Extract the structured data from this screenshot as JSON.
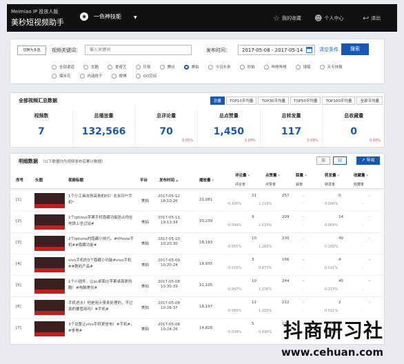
{
  "header": {
    "brand_sub": "Meimiao IP 投放人版",
    "brand_main": "美秒短视频助手",
    "skill_label": "一色神技能",
    "fav_label": "我的收藏",
    "user_label": "个人中心",
    "logout_label": "退出"
  },
  "filters": {
    "switch_label": "切换为多选",
    "keyword_label": "视频关键词：",
    "keyword_placeholder": "输入关键词",
    "date_label": "发布时间：",
    "date_value": "2017-05-08 - 2017-05-14",
    "clear_label": "清空条件",
    "search_label": "搜索",
    "platforms": [
      "全部渠道",
      "优酷",
      "爱奇艺",
      "乐视",
      "腾讯",
      "美拍",
      "今日头条",
      "秒拍",
      "哔哩哔哩",
      "搜狐",
      "天天快报",
      "爆米花",
      "内涵段子",
      "微博",
      "QQ空间"
    ],
    "selected_platform": "美拍"
  },
  "summary": {
    "title": "全部视频汇总数据",
    "tabs": [
      "总量",
      "TOP10平均量",
      "TOP30平均量",
      "TOP50平均量",
      "TOP100平均量",
      "全部平均量"
    ],
    "stats": [
      {
        "label": "视频数",
        "value": "7",
        "pct": ""
      },
      {
        "label": "总播放量",
        "value": "132,566",
        "pct": ""
      },
      {
        "label": "总评论量",
        "value": "70",
        "pct": "0.05%"
      },
      {
        "label": "总点赞量",
        "value": "1,450",
        "pct": "1.09%"
      },
      {
        "label": "总转发量",
        "value": "117",
        "pct": "0.09%"
      },
      {
        "label": "总收藏量",
        "value": "0",
        "pct": "0.00%"
      }
    ]
  },
  "detail": {
    "title": "明细数据",
    "subtitle": "（以下数据均为视频发布后累计数据）",
    "export_label": "导出",
    "columns": {
      "idx": "序号",
      "thumb": "头图",
      "title": "视频标题",
      "platform": "平台",
      "pubtime": "发布时间",
      "play": "播放量",
      "comment": "评论量",
      "comment_rate": "评论率",
      "like": "点赞量",
      "like_rate": "点赞率",
      "dislike": "踩量",
      "dislike_rate": "踩率",
      "share": "转发量",
      "share_rate": "转发率",
      "fav": "收藏量",
      "fav_rate": "收藏率"
    },
    "rows": [
      {
        "idx": "[1]",
        "title": "1个小工具击败高贵的PS！去水印**手机*",
        "platform": "美拍",
        "date": "2017-05-12",
        "time": "18:10:26",
        "play": "21,081",
        "comment": "21",
        "comment_rate": "0.100%",
        "like": "257",
        "like_rate": "1.219%",
        "dislike": "-",
        "dislike_rate": "-",
        "share": "0",
        "share_rate": "0.000%",
        "fav": "-",
        "fav_rate": "-"
      },
      {
        "idx": "[2]",
        "title": "1个iphone苹果手机隐藏功能防止你在地铁上坐过站#",
        "platform": "美拍",
        "date": "2017-05-11",
        "time": "19:13:34",
        "play": "20,239",
        "comment": "9",
        "comment_rate": "0.044%",
        "like": "209",
        "like_rate": "1.033%",
        "dislike": "-",
        "dislike_rate": "-",
        "share": "14",
        "share_rate": "0.069%",
        "fav": "-",
        "fav_rate": "-"
      },
      {
        "idx": "[3]",
        "title": "2个iphone的隐藏小技巧。#iPhone手机##隐藏功能#",
        "platform": "美拍",
        "date": "2017-05-10",
        "time": "10:20:30",
        "play": "18,183",
        "comment": "10",
        "comment_rate": "0.055%",
        "like": "230",
        "like_rate": "1.265%",
        "dislike": "-",
        "dislike_rate": "-",
        "share": "49",
        "share_rate": "0.269%",
        "fav": "-",
        "fav_rate": "-"
      },
      {
        "idx": "[4]",
        "title": "vivo手机的3个隐藏小功能#vivo手机##数码产品#",
        "platform": "美拍",
        "date": "2017-05-09",
        "time": "10:20:24",
        "play": "18,935",
        "comment": "3",
        "comment_rate": "0.016%",
        "like": "166",
        "like_rate": "0.877%",
        "dislike": "-",
        "dislike_rate": "-",
        "share": "4",
        "share_rate": "0.021%",
        "fav": "-",
        "fav_rate": "-"
      },
      {
        "idx": "[5]",
        "title": "1个小插件，让pc桌面比苹果桌面更炫酷！#电脑美化#",
        "platform": "美拍",
        "date": "2017-05-08",
        "time": "10:30:39",
        "play": "21,105",
        "comment": "10",
        "comment_rate": "0.047%",
        "like": "244",
        "like_rate": "1.156%",
        "dislike": "-",
        "dislike_rate": "-",
        "share": "45",
        "share_rate": "0.213%",
        "fav": "-",
        "fav_rate": "-"
      },
      {
        "idx": "[6]",
        "title": "手机进水！他是用火来来处理的，不过真的要管用吗！#手机#",
        "platform": "美拍",
        "date": "2017-05-08",
        "time": "10:26:37",
        "play": "18,197",
        "comment": "12",
        "comment_rate": "0.066%",
        "like": "212",
        "like_rate": "1.165%",
        "dislike": "-",
        "dislike_rate": "-",
        "share": "2",
        "share_rate": "0.011%",
        "fav": "-",
        "fav_rate": "-"
      },
      {
        "idx": "[7]",
        "title": "3个设置让vivo手机更省电！#手机#，#省电#",
        "platform": "美拍",
        "date": "2017-05-08",
        "time": "10:24:26",
        "play": "14,826",
        "comment": "5",
        "comment_rate": "0.034%",
        "like": "132",
        "like_rate": "0.890%",
        "dislike": "-",
        "dislike_rate": "-",
        "share": "3",
        "share_rate": "0.020%",
        "fav": "-",
        "fav_rate": "-"
      }
    ]
  },
  "watermark": {
    "text": "抖商研习社",
    "url": "www.cehuan.com"
  }
}
